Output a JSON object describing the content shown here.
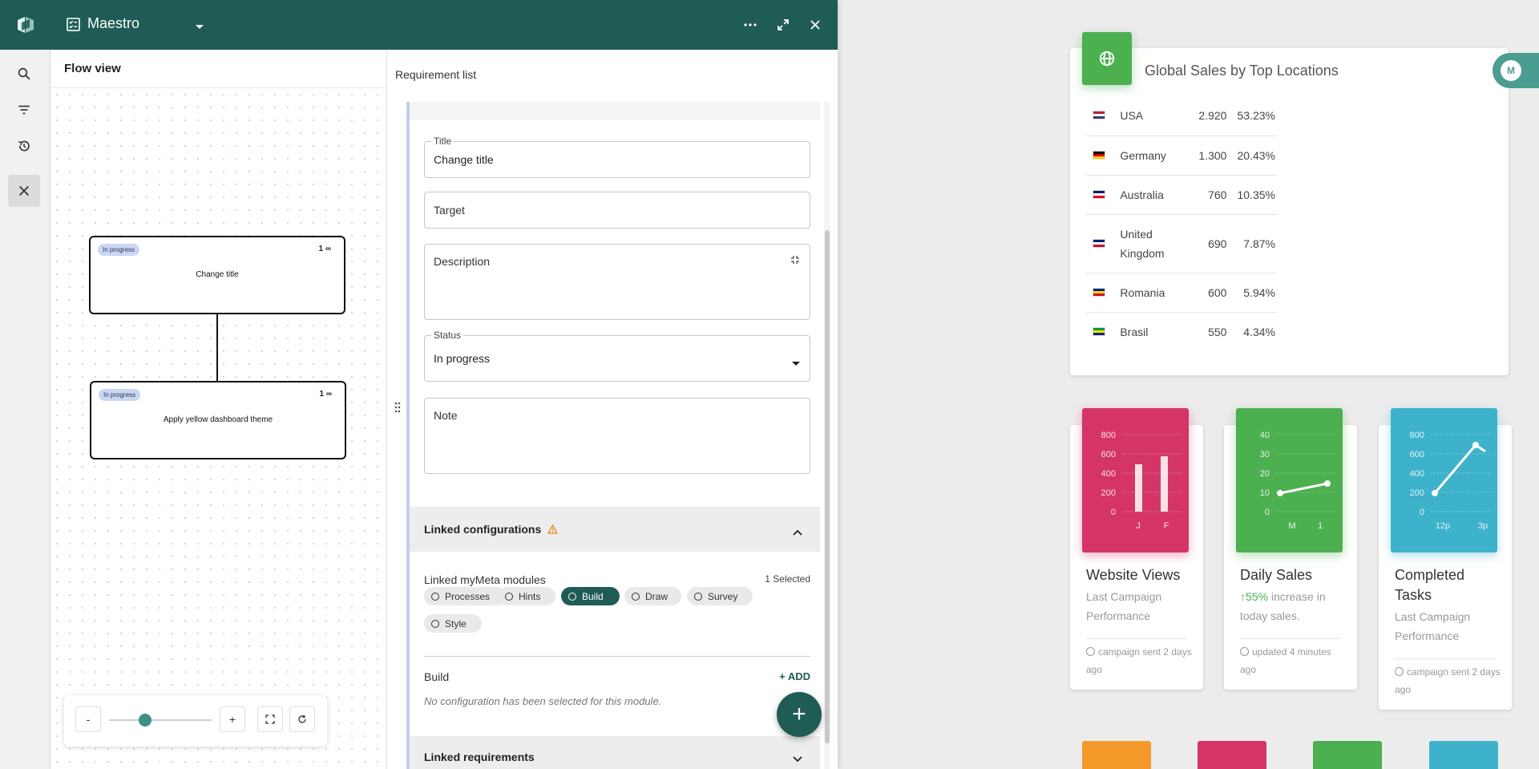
{
  "app": {
    "name": "Maestro"
  },
  "flow": {
    "title": "Flow view",
    "nodes": [
      {
        "status": "In progress",
        "count": "1",
        "title": "Change title"
      },
      {
        "status": "In progress",
        "count": "1",
        "title": "Apply yellow dashboard theme"
      }
    ],
    "zoom": {
      "minus": "-",
      "plus": "+",
      "level": 0.35
    }
  },
  "requirement": {
    "header": "Requirement list",
    "title_label": "Title",
    "title_value": "Change title",
    "target_placeholder": "Target",
    "description_placeholder": "Description",
    "status_label": "Status",
    "status_value": "In progress",
    "note_placeholder": "Note",
    "linked_configurations": "Linked configurations",
    "linked_modules_title": "Linked myMeta modules",
    "selected_count": "1 Selected",
    "modules": [
      {
        "label": "Processes",
        "selected": false
      },
      {
        "label": "Hints",
        "selected": false
      },
      {
        "label": "Build",
        "selected": true
      },
      {
        "label": "Draw",
        "selected": false
      },
      {
        "label": "Survey",
        "selected": false
      },
      {
        "label": "Style",
        "selected": false
      }
    ],
    "build_title": "Build",
    "add_label": "ADD",
    "empty_message": "No configuration has been selected for this module.",
    "linked_requirements": "Linked requirements"
  },
  "dashboard": {
    "sales_title": "Global Sales by Top Locations",
    "avatar_initial": "M",
    "sales": [
      {
        "country": "USA",
        "value": "2.920",
        "pct": "53.23%",
        "flag": [
          "#b22234",
          "#ffffff",
          "#3c3b6e"
        ]
      },
      {
        "country": "Germany",
        "value": "1.300",
        "pct": "20.43%",
        "flag": [
          "#000000",
          "#dd0000",
          "#ffce00"
        ]
      },
      {
        "country": "Australia",
        "value": "760",
        "pct": "10.35%",
        "flag": [
          "#012169",
          "#ffffff",
          "#e4002b"
        ]
      },
      {
        "country": "United Kingdom",
        "value": "690",
        "pct": "7.87%",
        "flag": [
          "#012169",
          "#ffffff",
          "#c8102e"
        ]
      },
      {
        "country": "Romania",
        "value": "600",
        "pct": "5.94%",
        "flag": [
          "#002b7f",
          "#fcd116",
          "#ce1126"
        ]
      },
      {
        "country": "Brasil",
        "value": "550",
        "pct": "4.34%",
        "flag": [
          "#009c3b",
          "#ffdf00",
          "#002776"
        ]
      }
    ],
    "cards": [
      {
        "title": "Website Views",
        "subtitle": "Last Campaign Performance",
        "highlight": "",
        "footer": "campaign sent 2 days ago",
        "color": "#d43566",
        "yticks": [
          "800",
          "600",
          "400",
          "200",
          "0"
        ],
        "xticks": [
          "J",
          "F"
        ]
      },
      {
        "title": "Daily Sales",
        "subtitle": "increase in today sales.",
        "highlight": "55%",
        "footer": "updated 4 minutes ago",
        "color": "#4caf50",
        "yticks": [
          "40",
          "30",
          "20",
          "10",
          "0"
        ],
        "xticks": [
          "M",
          "1"
        ]
      },
      {
        "title": "Completed Tasks",
        "subtitle": "Last Campaign Performance",
        "highlight": "",
        "footer": "campaign sent 2 days ago",
        "color": "#3eb2cb",
        "yticks": [
          "800",
          "600",
          "400",
          "200",
          "0"
        ],
        "xticks": [
          "12p",
          "3p"
        ]
      }
    ],
    "bottom_tabs": [
      "#f39a2a",
      "#d43566",
      "#4caf50",
      "#3eb2cb"
    ]
  }
}
